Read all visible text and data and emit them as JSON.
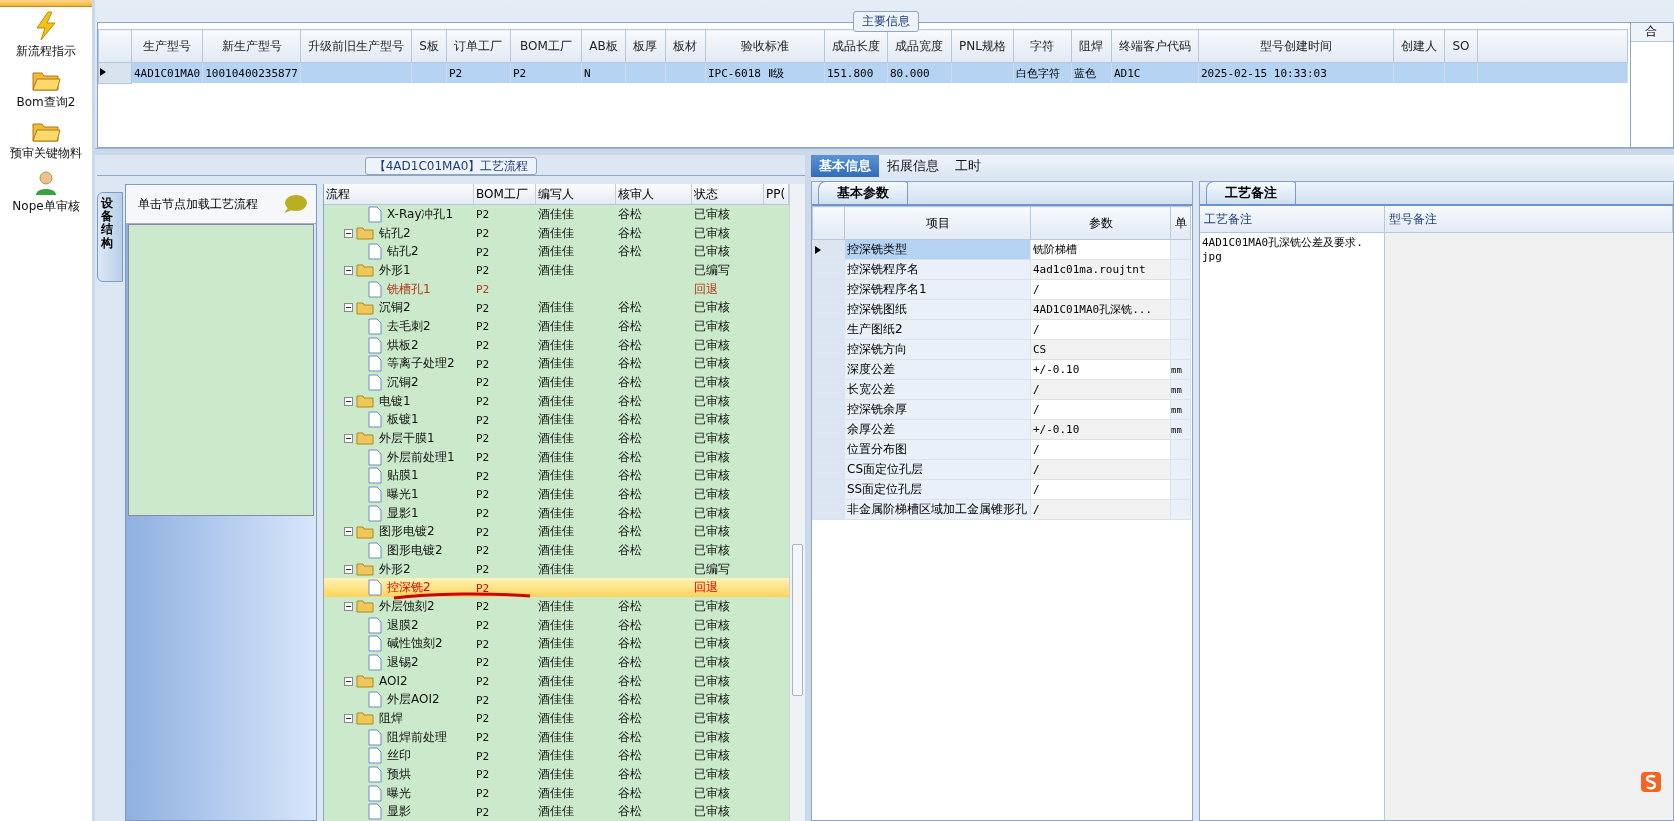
{
  "sidebar": {
    "items": [
      {
        "label": "新流程指示",
        "kind": "lightning",
        "selected": false
      },
      {
        "label": "Bom查询2",
        "kind": "folder",
        "selected": false
      },
      {
        "label": "预审关键物料",
        "kind": "folder",
        "selected": false
      },
      {
        "label": "Nope单审核",
        "kind": "person",
        "selected": false
      }
    ]
  },
  "main_info": {
    "title": "主要信息",
    "columns": [
      "生产型号",
      "新生产型号",
      "升级前旧生产型号",
      "S板",
      "订单工厂",
      "BOM工厂",
      "AB板",
      "板厚",
      "板材",
      "验收标准",
      "成品长度",
      "成品宽度",
      "PNL规格",
      "字符",
      "阻焊",
      "终端客户代码",
      "型号创建时间",
      "创建人",
      "SO"
    ],
    "rows": [
      {
        "selected": true,
        "cells": [
          "4AD1C01MA0",
          "10010400235877",
          "",
          "",
          "P2",
          "P2",
          "N",
          "",
          "",
          "IPC-6018 Ⅱ级",
          "151.800",
          "80.000",
          "",
          "白色字符",
          "蓝色",
          "AD1C",
          "2025-02-15 10:33:03",
          "",
          ""
        ]
      }
    ],
    "side_column": "合"
  },
  "process": {
    "title": "【4AD1C01MA0】工艺流程",
    "side_tab": "设备结构",
    "hint": "单击节点加载工艺流程",
    "columns": [
      "流程",
      "BOM工厂",
      "编写人",
      "核审人",
      "状态",
      "PP("
    ],
    "tree": [
      {
        "kind": "step",
        "name": "X-Ray冲孔1",
        "bom": "P2",
        "writer": "酒佳佳",
        "reviewer": "谷松",
        "status": "已审核",
        "returned": false,
        "selected": false
      },
      {
        "kind": "folder",
        "name": "钻孔2",
        "bom": "P2",
        "writer": "酒佳佳",
        "reviewer": "谷松",
        "status": "已审核",
        "returned": false,
        "selected": false,
        "expanded": true,
        "children": [
          {
            "kind": "step",
            "name": "钻孔2",
            "bom": "P2",
            "writer": "酒佳佳",
            "reviewer": "谷松",
            "status": "已审核",
            "returned": false,
            "selected": false
          }
        ]
      },
      {
        "kind": "folder",
        "name": "外形1",
        "bom": "P2",
        "writer": "酒佳佳",
        "status": "已编写",
        "returned": false,
        "selected": false,
        "expanded": true,
        "children": [
          {
            "kind": "step",
            "name": "铣槽孔1",
            "bom": "P2",
            "status": "回退",
            "returned": true,
            "selected": false
          }
        ]
      },
      {
        "kind": "folder",
        "name": "沉铜2",
        "bom": "P2",
        "writer": "酒佳佳",
        "reviewer": "谷松",
        "status": "已审核",
        "returned": false,
        "selected": false,
        "expanded": true,
        "children": [
          {
            "kind": "step",
            "name": "去毛刺2",
            "bom": "P2",
            "writer": "酒佳佳",
            "reviewer": "谷松",
            "status": "已审核",
            "returned": false,
            "selected": false
          },
          {
            "kind": "step",
            "name": "烘板2",
            "bom": "P2",
            "writer": "酒佳佳",
            "reviewer": "谷松",
            "status": "已审核",
            "returned": false,
            "selected": false
          },
          {
            "kind": "step",
            "name": "等离子处理2",
            "bom": "P2",
            "writer": "酒佳佳",
            "reviewer": "谷松",
            "status": "已审核",
            "returned": false,
            "selected": false
          },
          {
            "kind": "step",
            "name": "沉铜2",
            "bom": "P2",
            "writer": "酒佳佳",
            "reviewer": "谷松",
            "status": "已审核",
            "returned": false,
            "selected": false
          }
        ]
      },
      {
        "kind": "folder",
        "name": "电镀1",
        "bom": "P2",
        "writer": "酒佳佳",
        "reviewer": "谷松",
        "status": "已审核",
        "returned": false,
        "selected": false,
        "expanded": true,
        "children": [
          {
            "kind": "step",
            "name": "板镀1",
            "bom": "P2",
            "writer": "酒佳佳",
            "reviewer": "谷松",
            "status": "已审核",
            "returned": false,
            "selected": false
          }
        ]
      },
      {
        "kind": "folder",
        "name": "外层干膜1",
        "bom": "P2",
        "writer": "酒佳佳",
        "reviewer": "谷松",
        "status": "已审核",
        "returned": false,
        "selected": false,
        "expanded": true,
        "children": [
          {
            "kind": "step",
            "name": "外层前处理1",
            "bom": "P2",
            "writer": "酒佳佳",
            "reviewer": "谷松",
            "status": "已审核",
            "returned": false,
            "selected": false
          },
          {
            "kind": "step",
            "name": "贴膜1",
            "bom": "P2",
            "writer": "酒佳佳",
            "reviewer": "谷松",
            "status": "已审核",
            "returned": false,
            "selected": false
          },
          {
            "kind": "step",
            "name": "曝光1",
            "bom": "P2",
            "writer": "酒佳佳",
            "reviewer": "谷松",
            "status": "已审核",
            "returned": false,
            "selected": false
          },
          {
            "kind": "step",
            "name": "显影1",
            "bom": "P2",
            "writer": "酒佳佳",
            "reviewer": "谷松",
            "status": "已审核",
            "returned": false,
            "selected": false
          }
        ]
      },
      {
        "kind": "folder",
        "name": "图形电镀2",
        "bom": "P2",
        "writer": "酒佳佳",
        "reviewer": "谷松",
        "status": "已审核",
        "returned": false,
        "selected": false,
        "expanded": true,
        "children": [
          {
            "kind": "step",
            "name": "图形电镀2",
            "bom": "P2",
            "writer": "酒佳佳",
            "reviewer": "谷松",
            "status": "已审核",
            "returned": false,
            "selected": false
          }
        ]
      },
      {
        "kind": "folder",
        "name": "外形2",
        "bom": "P2",
        "writer": "酒佳佳",
        "status": "已编写",
        "returned": false,
        "selected": false,
        "expanded": true,
        "children": [
          {
            "kind": "step",
            "name": "控深铣2",
            "bom": "P2",
            "status": "回退",
            "returned": true,
            "selected": true,
            "underlined": true
          }
        ]
      },
      {
        "kind": "folder",
        "name": "外层蚀刻2",
        "bom": "P2",
        "writer": "酒佳佳",
        "reviewer": "谷松",
        "status": "已审核",
        "returned": false,
        "selected": false,
        "expanded": true,
        "children": [
          {
            "kind": "step",
            "name": "退膜2",
            "bom": "P2",
            "writer": "酒佳佳",
            "reviewer": "谷松",
            "status": "已审核",
            "returned": false,
            "selected": false
          },
          {
            "kind": "step",
            "name": "碱性蚀刻2",
            "bom": "P2",
            "writer": "酒佳佳",
            "reviewer": "谷松",
            "status": "已审核",
            "returned": false,
            "selected": false
          },
          {
            "kind": "step",
            "name": "退锡2",
            "bom": "P2",
            "writer": "酒佳佳",
            "reviewer": "谷松",
            "status": "已审核",
            "returned": false,
            "selected": false
          }
        ]
      },
      {
        "kind": "folder",
        "name": "AOI2",
        "bom": "P2",
        "writer": "酒佳佳",
        "reviewer": "谷松",
        "status": "已审核",
        "returned": false,
        "selected": false,
        "expanded": true,
        "children": [
          {
            "kind": "step",
            "name": "外层AOI2",
            "bom": "P2",
            "writer": "酒佳佳",
            "reviewer": "谷松",
            "status": "已审核",
            "returned": false,
            "selected": false
          }
        ]
      },
      {
        "kind": "folder",
        "name": "阻焊",
        "bom": "P2",
        "writer": "酒佳佳",
        "reviewer": "谷松",
        "status": "已审核",
        "returned": false,
        "selected": false,
        "expanded": true,
        "children": [
          {
            "kind": "step",
            "name": "阻焊前处理",
            "bom": "P2",
            "writer": "酒佳佳",
            "reviewer": "谷松",
            "status": "已审核",
            "returned": false,
            "selected": false
          },
          {
            "kind": "step",
            "name": "丝印",
            "bom": "P2",
            "writer": "酒佳佳",
            "reviewer": "谷松",
            "status": "已审核",
            "returned": false,
            "selected": false
          },
          {
            "kind": "step",
            "name": "预烘",
            "bom": "P2",
            "writer": "酒佳佳",
            "reviewer": "谷松",
            "status": "已审核",
            "returned": false,
            "selected": false
          },
          {
            "kind": "step",
            "name": "曝光",
            "bom": "P2",
            "writer": "酒佳佳",
            "reviewer": "谷松",
            "status": "已审核",
            "returned": false,
            "selected": false
          },
          {
            "kind": "step",
            "name": "显影",
            "bom": "P2",
            "writer": "酒佳佳",
            "reviewer": "谷松",
            "status": "已审核",
            "returned": false,
            "selected": false
          }
        ]
      }
    ]
  },
  "detail": {
    "tabs": [
      {
        "label": "基本信息",
        "selected": true
      },
      {
        "label": "拓展信息",
        "selected": false
      },
      {
        "label": "工时",
        "selected": false
      }
    ],
    "params": {
      "tab": "基本参数",
      "columns": [
        "项目",
        "参数",
        "单"
      ],
      "rows": [
        {
          "item": "控深铣类型",
          "value": "铣阶梯槽",
          "selected": true
        },
        {
          "item": "控深铣程序名",
          "value": "4ad1c01ma.roujtnt",
          "selected": false
        },
        {
          "item": "控深铣程序名1",
          "value": "/",
          "selected": false
        },
        {
          "item": "控深铣图纸",
          "value": "4AD1C01MA0孔深铣...",
          "selected": false
        },
        {
          "item": "生产图纸2",
          "value": "/",
          "selected": false
        },
        {
          "item": "控深铣方向",
          "value": "CS",
          "selected": false
        },
        {
          "item": "深度公差",
          "value": "+/-0.10",
          "unit": "mm",
          "selected": false
        },
        {
          "item": "长宽公差",
          "value": "/",
          "unit": "mm",
          "selected": false
        },
        {
          "item": "控深铣余厚",
          "value": "/",
          "unit": "mm",
          "selected": false
        },
        {
          "item": "余厚公差",
          "value": "+/-0.10",
          "unit": "mm",
          "selected": false
        },
        {
          "item": "位置分布图",
          "value": "/",
          "selected": false
        },
        {
          "item": "CS面定位孔层",
          "value": "/",
          "selected": false
        },
        {
          "item": "SS面定位孔层",
          "value": "/",
          "selected": false
        },
        {
          "item": "非金属阶梯槽区域加工金属锥形孔",
          "value": "/",
          "selected": false
        }
      ]
    },
    "notes": {
      "tab": "工艺备注",
      "columns": [
        "工艺备注",
        "型号备注"
      ],
      "text": "4AD1C01MA0孔深铣公差及要求.jpg"
    }
  }
}
